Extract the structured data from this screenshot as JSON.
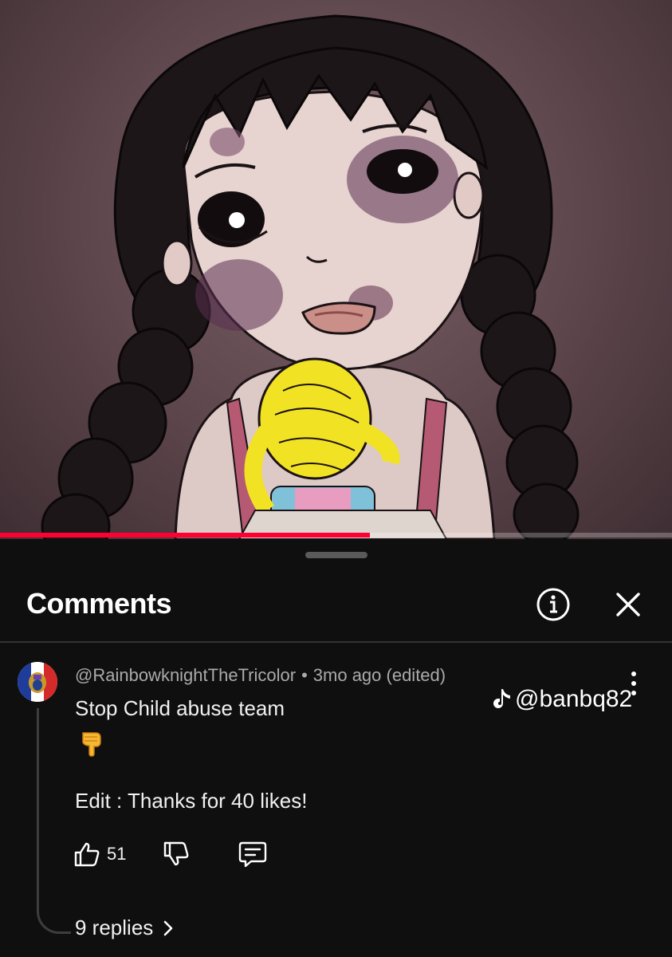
{
  "video": {
    "progress_fraction": 0.55
  },
  "comments_sheet": {
    "title": "Comments",
    "info_icon": "info-circle-icon",
    "close_icon": "close-icon"
  },
  "comment": {
    "author": "@RainbowknightTheTricolor",
    "separator": "•",
    "timestamp": "3mo ago (edited)",
    "text": "Stop Child abuse team",
    "emoji": "pointing-down-emoji",
    "edit_text": "Edit : Thanks for 40 likes!",
    "like_count": "51",
    "replies_label": "9 replies"
  },
  "watermark": {
    "text": "@banbq82",
    "icon": "tiktok-note-icon"
  },
  "colors": {
    "background": "#0f0f0f",
    "progress": "#ff0033",
    "meta_text": "#aaaaaa"
  }
}
